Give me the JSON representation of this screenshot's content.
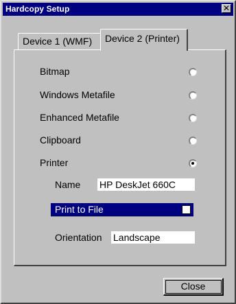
{
  "window": {
    "title": "Hardcopy Setup",
    "close_glyph": "✕"
  },
  "tabs": [
    {
      "label": "Device 1 (WMF)",
      "active": false
    },
    {
      "label": "Device 2 (Printer)",
      "active": true
    }
  ],
  "options": [
    {
      "label": "Bitmap",
      "selected": false
    },
    {
      "label": "Windows Metafile",
      "selected": false
    },
    {
      "label": "Enhanced Metafile",
      "selected": false
    },
    {
      "label": "Clipboard",
      "selected": false
    },
    {
      "label": "Printer",
      "selected": true
    }
  ],
  "printer": {
    "name_label": "Name",
    "name_value": "HP DeskJet 660C",
    "print_to_file_label": "Print to File",
    "print_to_file_checked": false,
    "orientation_label": "Orientation",
    "orientation_value": "Landscape"
  },
  "buttons": {
    "close_label": "Close"
  },
  "colors": {
    "titlebar": "#000080",
    "face": "#c0c0c0",
    "highlight": "#000080"
  }
}
